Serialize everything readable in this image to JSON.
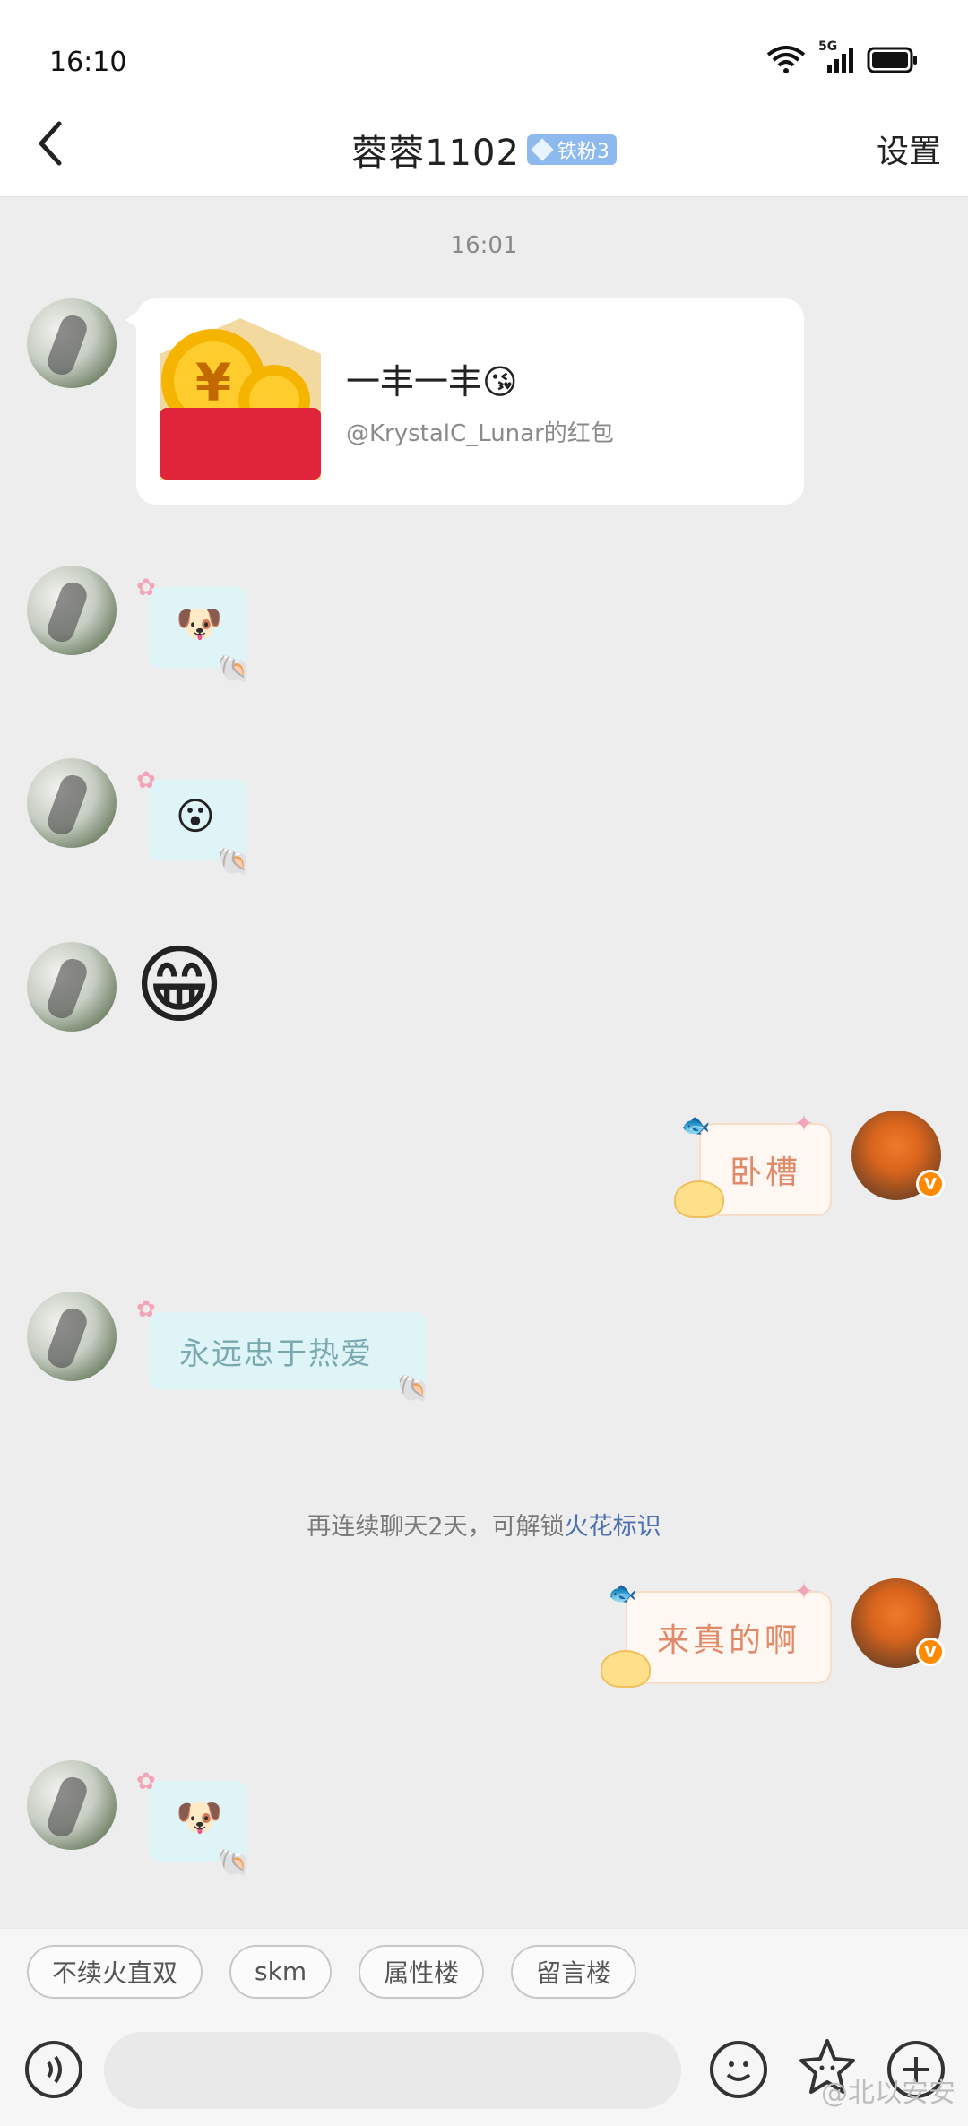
{
  "status_bar": {
    "time": "16:10",
    "network": "5G"
  },
  "header": {
    "title": "蓉蓉1102",
    "badge": "铁粉3",
    "settings_label": "设置"
  },
  "chat": {
    "timestamp": "16:01",
    "red_packet": {
      "title": "一丰一丰😘",
      "subtitle": "@KrystalC_Lunar的红包"
    },
    "messages": [
      {
        "side": "left",
        "kind": "sticker",
        "emoji": "🐶"
      },
      {
        "side": "left",
        "kind": "sticker",
        "emoji": "😮"
      },
      {
        "side": "left",
        "kind": "big-emoji",
        "emoji": "😁"
      },
      {
        "side": "right",
        "kind": "text",
        "text": "卧槽"
      },
      {
        "side": "left",
        "kind": "text",
        "text": "永远忠于热爱"
      },
      {
        "side": "right",
        "kind": "text",
        "text": "来真的啊"
      },
      {
        "side": "left",
        "kind": "sticker",
        "emoji": "🐶"
      }
    ],
    "system_tip": {
      "text": "再连续聊天2天，可解锁",
      "link": "火花标识"
    }
  },
  "quick_replies": [
    "不续火直双",
    "skm",
    "属性楼",
    "留言楼"
  ],
  "input": {
    "placeholder": ""
  },
  "watermark": "@北以安安"
}
